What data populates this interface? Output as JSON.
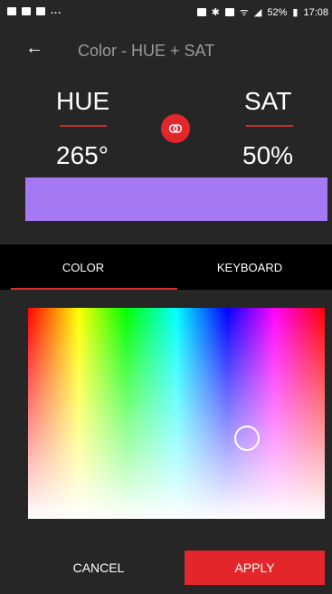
{
  "status_bar": {
    "left_icons": [
      "image-icon",
      "media-icon",
      "mail-icon"
    ],
    "left_more": "...",
    "right_icons": [
      "alarm-icon",
      "bluetooth-icon",
      "mute-icon",
      "wifi-icon",
      "signal-icon"
    ],
    "battery_percent": "52%",
    "time": "17:08"
  },
  "app_bar": {
    "back_icon": "arrow-left-icon",
    "title": "Color - HUE + SAT"
  },
  "hue": {
    "label": "HUE",
    "value": "265°"
  },
  "sat": {
    "label": "SAT",
    "value": "50%"
  },
  "link_button": {
    "icon": "link-rings-icon"
  },
  "preview": {
    "color": "#a679f4"
  },
  "tabs": [
    {
      "label": "COLOR",
      "selected": true
    },
    {
      "label": "KEYBOARD",
      "selected": false
    }
  ],
  "picker": {
    "hue_degrees": 265,
    "saturation_percent": 50
  },
  "actions": {
    "cancel_label": "CANCEL",
    "apply_label": "APPLY"
  },
  "colors": {
    "background": "#262626",
    "accent": "#e3262b",
    "tab_bar": "#000000"
  }
}
